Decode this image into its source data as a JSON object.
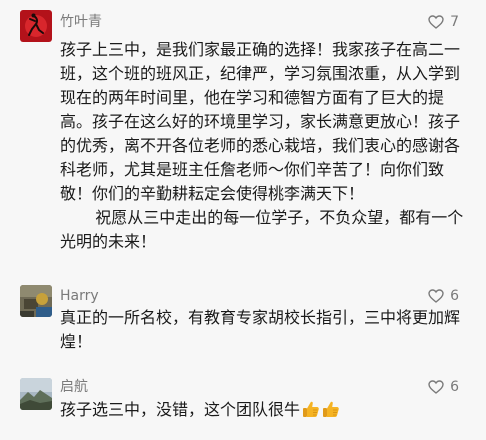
{
  "comments": [
    {
      "author": "竹叶青",
      "likes": "7",
      "avatar_icon": "red-dancer-avatar-icon",
      "paragraphs": [
        "孩子上三中，是我们家最正确的选择！我家孩子在高二一班，这个班的班风正，纪律严，学习氛围浓重，从入学到现在的两年时间里，他在学习和德智方面有了巨大的提高。孩子在这么好的环境里学习，家长满意更放心！孩子的优秀，离不开各位老师的悉心栽培，我们衷心的感谢各科老师，尤其是班主任詹老师～你们辛苦了！向你们致敬！你们的辛勤耕耘定会使得桃李满天下！",
        "祝愿从三中走出的每一位学子，不负众望，都有一个光明的未来！"
      ]
    },
    {
      "author": "Harry",
      "likes": "6",
      "avatar_icon": "photo-avatar-icon",
      "paragraphs": [
        "真正的一所名校，有教育专家胡校长指引，三中将更加辉煌！"
      ]
    },
    {
      "author": "启航",
      "likes": "6",
      "avatar_icon": "landscape-avatar-icon",
      "paragraphs": [
        "孩子选三中，没错，这个团队很牛"
      ],
      "emoji": [
        "thumbs-up-icon",
        "thumbs-up-icon"
      ]
    }
  ],
  "colors": {
    "background": "#f7f7f7",
    "name_text": "#7a7a7a",
    "body_text": "#1a1a1a",
    "avatar1_bg": "#b3121a",
    "thumb_yellow": "#f5b323"
  }
}
